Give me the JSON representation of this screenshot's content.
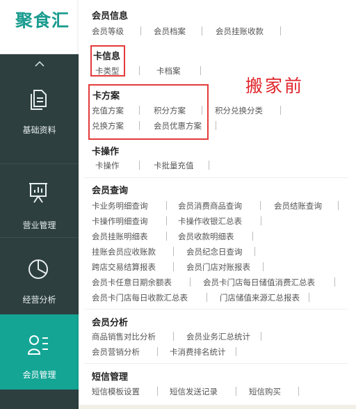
{
  "sidebar": {
    "logo": "聚食汇",
    "nav": [
      {
        "label": "基础资料",
        "icon": "document-icon"
      },
      {
        "label": "营业管理",
        "icon": "presentation-chart-icon"
      },
      {
        "label": "经营分析",
        "icon": "pie-chart-icon"
      },
      {
        "label": "会员管理",
        "icon": "member-list-icon",
        "active": true
      }
    ]
  },
  "menu": {
    "member_info": {
      "title": "会员信息",
      "links": [
        "会员等级",
        "会员档案",
        "会员挂账收款"
      ]
    },
    "card_info": {
      "title": "卡信息",
      "links": [
        "卡类型",
        "卡档案"
      ]
    },
    "card_scheme": {
      "title": "卡方案",
      "links": [
        "充值方案",
        "积分方案",
        "积分兑换分类",
        "兑换方案",
        "会员优惠方案"
      ]
    },
    "card_ops": {
      "title": "卡操作",
      "links": [
        "卡操作",
        "卡批量充值"
      ]
    },
    "member_query": {
      "title": "会员查询",
      "links": [
        "卡业务明细查询",
        "会员消费商品查询",
        "会员结账查询",
        "卡操作明细查询",
        "卡操作收银汇总表",
        "会员挂账明细表",
        "会员收款明细表",
        "挂账会员应收账款",
        "会员纪念日查询",
        "跨店交易结算报表",
        "会员门店对账报表",
        "会员卡任意日期余额表",
        "会员卡门店每日储值消费汇总表",
        "会员卡门店每日收款汇总表",
        "门店储值来源汇总报表"
      ]
    },
    "member_analysis": {
      "title": "会员分析",
      "links": [
        "商品销售对比分析",
        "会员业务汇总统计",
        "会员营销分析",
        "卡消费排名统计"
      ]
    },
    "sms": {
      "title": "短信管理",
      "links": [
        "短信模板设置",
        "短信发送记录",
        "短信购买"
      ]
    }
  },
  "annotation": "搬家前",
  "colors": {
    "sidebar_bg": "#2d3f3f",
    "active_bg": "#14a595",
    "brand": "#1a9c8f",
    "highlight": "#e33a3a"
  }
}
